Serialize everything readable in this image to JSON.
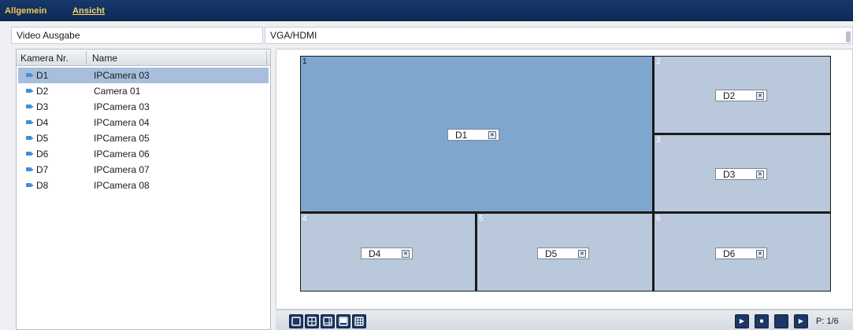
{
  "tabs": [
    {
      "label": "Allgemein"
    },
    {
      "label": "Ansicht"
    }
  ],
  "field": {
    "label": "Video Ausgabe",
    "value": "VGA/HDMI"
  },
  "camera_list": {
    "columns": [
      "Kamera Nr.",
      "Name"
    ],
    "rows": [
      {
        "nr": "D1",
        "name": "IPCamera 03"
      },
      {
        "nr": "D2",
        "name": "Camera 01"
      },
      {
        "nr": "D3",
        "name": "IPCamera 03"
      },
      {
        "nr": "D4",
        "name": "IPCamera 04"
      },
      {
        "nr": "D5",
        "name": "IPCamera 05"
      },
      {
        "nr": "D6",
        "name": "IPCamera 06"
      },
      {
        "nr": "D7",
        "name": "IPCamera 07"
      },
      {
        "nr": "D8",
        "name": "IPCamera 08"
      }
    ],
    "selected": "D1"
  },
  "layout": {
    "windows": [
      {
        "num": "1",
        "channel": "D1"
      },
      {
        "num": "2",
        "channel": "D2"
      },
      {
        "num": "3",
        "channel": "D3"
      },
      {
        "num": "4",
        "channel": "D4"
      },
      {
        "num": "5",
        "channel": "D5"
      },
      {
        "num": "6",
        "channel": "D6"
      }
    ],
    "close_glyph": "×"
  },
  "layout_buttons": [
    "layout-1x1-icon",
    "layout-2x2-icon",
    "layout-1plus5-icon",
    "layout-1plus7-icon",
    "layout-3x3-icon"
  ],
  "nav_buttons": [
    "play-icon",
    "stop-icon",
    "blank-icon",
    "next-icon"
  ],
  "pager": {
    "text": "P: 1/6"
  },
  "colors": {
    "topbar": "#17386b",
    "tab_text": "#f3c94a",
    "selected_row": "#a7bfdc",
    "main_window": "#7fa7cd",
    "sub_window": "#b9c8da"
  }
}
